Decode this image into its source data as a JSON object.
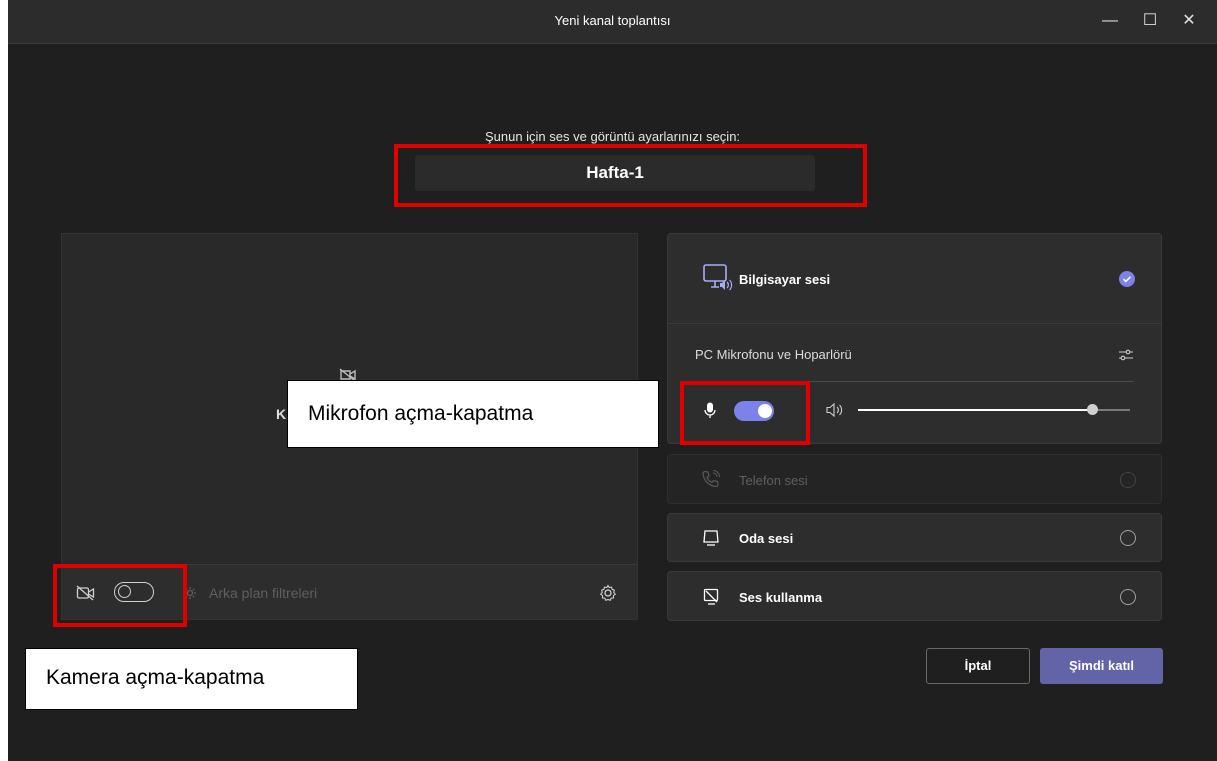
{
  "window": {
    "title": "Yeni kanal toplantısı",
    "controls": {
      "minimize": "—",
      "maximize": "☐",
      "close": "✕"
    }
  },
  "prompt": "Şunun için ses ve görüntü ayarlarınızı seçin:",
  "meeting_name": "Hafta-1",
  "preview": {
    "partial_text": "K",
    "background_filters": "Arka plan filtreleri",
    "camera_on": false
  },
  "audio": {
    "computer": {
      "label": "Bilgisayar sesi",
      "selected": true
    },
    "device_label": "PC Mikrofonu ve Hoparlörü",
    "mic_on": true,
    "speaker_volume": 0.86,
    "phone": {
      "label": "Telefon sesi",
      "disabled": true
    },
    "room": {
      "label": "Oda sesi"
    },
    "none": {
      "label": "Ses kullanma"
    }
  },
  "buttons": {
    "cancel": "İptal",
    "join": "Şimdi katıl"
  },
  "annotations": {
    "mic": "Mikrofon açma-kapatma",
    "camera": "Kamera açma-kapatma"
  },
  "colors": {
    "accent": "#7b83eb",
    "join_button": "#6264a7",
    "highlight": "#e00000"
  }
}
